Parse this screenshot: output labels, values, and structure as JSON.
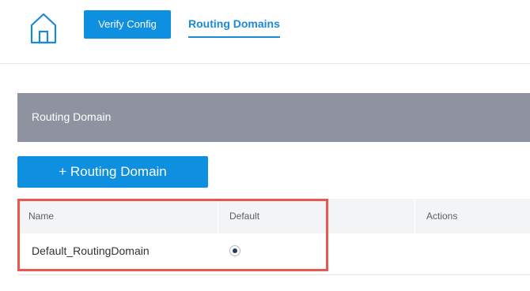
{
  "header": {
    "home_icon": "home-icon",
    "verify_button_label": "Verify Config",
    "active_tab_label": "Routing Domains"
  },
  "section": {
    "title": "Routing Domain",
    "add_button_label": "+ Routing Domain"
  },
  "table": {
    "columns": [
      "Name",
      "Default",
      "Actions"
    ],
    "rows": [
      {
        "name": "Default_RoutingDomain",
        "default": true
      }
    ]
  },
  "colors": {
    "accent": "#0e8fe0",
    "tab_text": "#1a8ad4",
    "section_header_bg": "#8e939f",
    "highlight": "#e8584f"
  }
}
